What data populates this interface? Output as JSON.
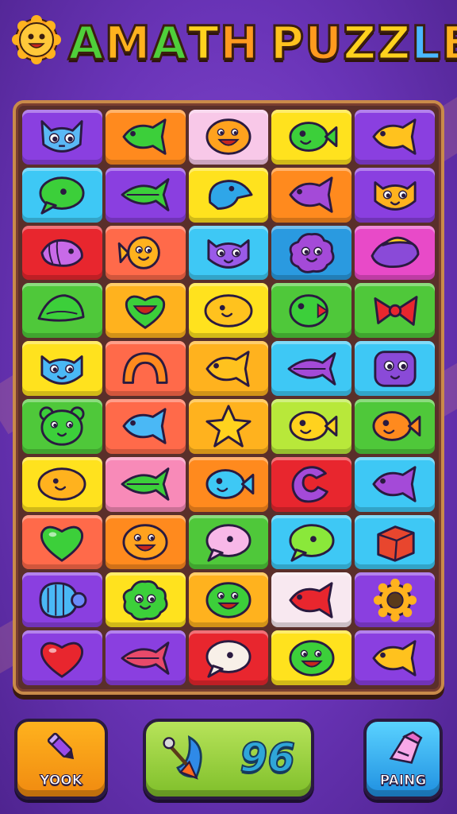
{
  "header": {
    "title_letters": [
      {
        "ch": "A",
        "color": "#4fcf3a"
      },
      {
        "ch": "M",
        "color": "#ffb21e"
      },
      {
        "ch": "A",
        "color": "#4fcf3a"
      },
      {
        "ch": "T",
        "color": "#ffd21e"
      },
      {
        "ch": "H",
        "color": "#ff9a1e"
      },
      {
        "ch": " ",
        "color": "#ffffff"
      },
      {
        "ch": "P",
        "color": "#ffc21e"
      },
      {
        "ch": "U",
        "color": "#ff9a1e"
      },
      {
        "ch": "Z",
        "color": "#ffd21e"
      },
      {
        "ch": "Z",
        "color": "#ffd21e"
      },
      {
        "ch": "L",
        "color": "#4ab8ff"
      },
      {
        "ch": "E",
        "color": "#ffb21e"
      }
    ],
    "logo_icon": "smiling-sun-icon"
  },
  "board": {
    "rows": [
      [
        {
          "bg": "#8a3fe0",
          "icon": "blue-cat-face",
          "c": "#5ab8f5"
        },
        {
          "bg": "#ff8a1e",
          "icon": "fish",
          "c": "#3ccf3a"
        },
        {
          "bg": "#f8c8e8",
          "icon": "smile-blob",
          "c": "#ffa21e"
        },
        {
          "bg": "#ffe21e",
          "icon": "fish-smile",
          "c": "#3ccf3a"
        },
        {
          "bg": "#8a3fe0",
          "icon": "fish",
          "c": "#ffc21e"
        }
      ],
      [
        {
          "bg": "#3ec8f5",
          "icon": "speech-blob",
          "c": "#3ccf3a"
        },
        {
          "bg": "#8a3fe0",
          "icon": "leaf-fish",
          "c": "#3ccf3a"
        },
        {
          "bg": "#ffe21e",
          "icon": "drop-bird",
          "c": "#2fa6e8"
        },
        {
          "bg": "#ff8a1e",
          "icon": "fish",
          "c": "#a44ad8"
        },
        {
          "bg": "#8a3fe0",
          "icon": "cat-face",
          "c": "#ffb21e"
        }
      ],
      [
        {
          "bg": "#e8262e",
          "icon": "shell-fish",
          "c": "#c86ae8"
        },
        {
          "bg": "#ff6a4a",
          "icon": "round-fish",
          "c": "#ffb21e"
        },
        {
          "bg": "#3ec8f5",
          "icon": "cat-face",
          "c": "#9a5ae8"
        },
        {
          "bg": "#2a9ae0",
          "icon": "puff-face",
          "c": "#a44ad8"
        },
        {
          "bg": "#e84ac8",
          "icon": "bean-moon",
          "c": "#8a4ad8"
        }
      ],
      [
        {
          "bg": "#4fc83a",
          "icon": "leaf-blob",
          "c": "#3ccf3a"
        },
        {
          "bg": "#ffb21e",
          "icon": "heart-smile",
          "c": "#3ccf3a"
        },
        {
          "bg": "#ffe21e",
          "icon": "lemon-face",
          "c": "#ffc21e"
        },
        {
          "bg": "#4fc83a",
          "icon": "fish-bite",
          "c": "#3ccf3a"
        },
        {
          "bg": "#4fc83a",
          "icon": "bow",
          "c": "#e8262e"
        }
      ],
      [
        {
          "bg": "#ffe21e",
          "icon": "cat-face",
          "c": "#4ab8f5"
        },
        {
          "bg": "#ff6a4a",
          "icon": "arch",
          "c": "#ff8a1e"
        },
        {
          "bg": "#ffb21e",
          "icon": "fish",
          "c": "#ffc21e"
        },
        {
          "bg": "#3ec8f5",
          "icon": "leaf-fish",
          "c": "#a44ad8"
        },
        {
          "bg": "#3ec8f5",
          "icon": "square-face",
          "c": "#8a4ad8"
        }
      ],
      [
        {
          "bg": "#4fc83a",
          "icon": "bear-face",
          "c": "#3ccf3a"
        },
        {
          "bg": "#ff6a4a",
          "icon": "fish",
          "c": "#4ab8f5"
        },
        {
          "bg": "#ffb21e",
          "icon": "star",
          "c": "#ffd21e"
        },
        {
          "bg": "#b8e83a",
          "icon": "fish-smile",
          "c": "#ffd21e"
        },
        {
          "bg": "#4fc83a",
          "icon": "fish-smile",
          "c": "#ff8a1e"
        }
      ],
      [
        {
          "bg": "#ffe21e",
          "icon": "lemon-face",
          "c": "#ffb21e"
        },
        {
          "bg": "#f88ab8",
          "icon": "leaf-fish",
          "c": "#3ccf3a"
        },
        {
          "bg": "#ff8a1e",
          "icon": "fish-smile",
          "c": "#3ec8f5"
        },
        {
          "bg": "#e8262e",
          "icon": "c-shape",
          "c": "#a44ad8"
        },
        {
          "bg": "#3ec8f5",
          "icon": "fish",
          "c": "#a44ad8"
        }
      ],
      [
        {
          "bg": "#ff6a4a",
          "icon": "heart",
          "c": "#3ccf3a"
        },
        {
          "bg": "#ff8a1e",
          "icon": "smile-blob",
          "c": "#ffa21e"
        },
        {
          "bg": "#4fc83a",
          "icon": "speech-blob",
          "c": "#f8b8e8"
        },
        {
          "bg": "#3ec8f5",
          "icon": "speech-blob",
          "c": "#8ae83a"
        },
        {
          "bg": "#3ec8f5",
          "icon": "cube",
          "c": "#e8462e"
        }
      ],
      [
        {
          "bg": "#8a3fe0",
          "icon": "shell-spiral",
          "c": "#4ab8f5"
        },
        {
          "bg": "#ffe21e",
          "icon": "puff-face",
          "c": "#3ccf3a"
        },
        {
          "bg": "#ffb21e",
          "icon": "smile-blob",
          "c": "#3ccf3a"
        },
        {
          "bg": "#f8e8f0",
          "icon": "fish",
          "c": "#e8262e"
        },
        {
          "bg": "#8a3fe0",
          "icon": "gear",
          "c": "#ffb21e"
        }
      ],
      [
        {
          "bg": "#8a3fe0",
          "icon": "heart",
          "c": "#e8262e"
        },
        {
          "bg": "#8a3fe0",
          "icon": "leaf-fish",
          "c": "#e84a6a"
        },
        {
          "bg": "#e8262e",
          "icon": "speech-blob",
          "c": "#f8f0e8"
        },
        {
          "bg": "#ffe21e",
          "icon": "smile-blob",
          "c": "#3ccf3a"
        },
        {
          "bg": "#8a3fe0",
          "icon": "fish",
          "c": "#ffc21e"
        }
      ]
    ]
  },
  "footer": {
    "left_button": {
      "label": "YOOK",
      "icon": "pencil-icon"
    },
    "score": {
      "icon": "arrow-shield-icon",
      "value": "96"
    },
    "right_button": {
      "label": "PAING",
      "icon": "brush-icon"
    }
  }
}
